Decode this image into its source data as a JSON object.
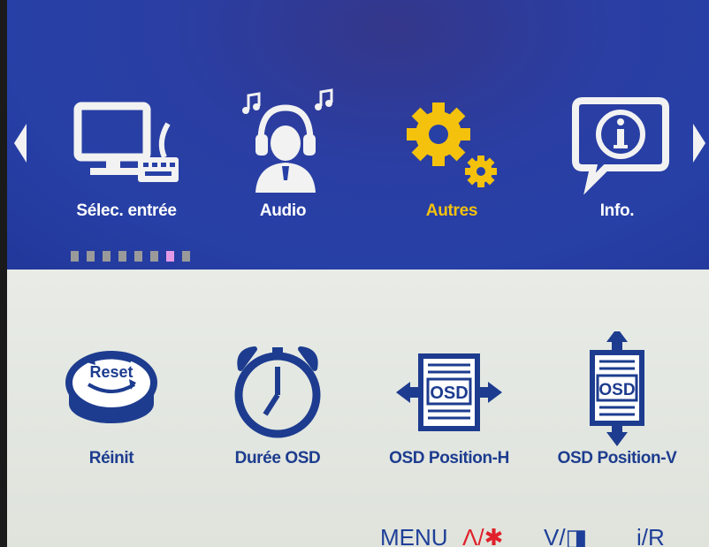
{
  "navigation": {
    "tabs": [
      {
        "label": "Sélec. entrée",
        "icon": "monitor-keyboard-icon",
        "active": false
      },
      {
        "label": "Audio",
        "icon": "headphones-person-icon",
        "active": false
      },
      {
        "label": "Autres",
        "icon": "gears-icon",
        "active": true
      },
      {
        "label": "Info.",
        "icon": "info-bubble-icon",
        "active": false
      }
    ],
    "page_dots_total": 8,
    "page_dots_active_index": 6
  },
  "settings": {
    "items": [
      {
        "label": "Réinit",
        "icon": "reset-icon",
        "icon_text": "Reset"
      },
      {
        "label": "Durée OSD",
        "icon": "alarm-clock-icon"
      },
      {
        "label": "OSD Position-H",
        "icon": "osd-horizontal-icon",
        "icon_text": "OSD"
      },
      {
        "label": "OSD Position-V",
        "icon": "osd-vertical-icon",
        "icon_text": "OSD"
      }
    ]
  },
  "footer": {
    "menu": "MENU",
    "up": "Λ/✱",
    "down": "V/◨",
    "input": "i/R"
  },
  "colors": {
    "top_bg": "#2740a6",
    "bottom_bg": "#e4e8e2",
    "active_label": "#f4c20d",
    "item_blue": "#1d3c8f",
    "footer_red": "#e0202b"
  }
}
